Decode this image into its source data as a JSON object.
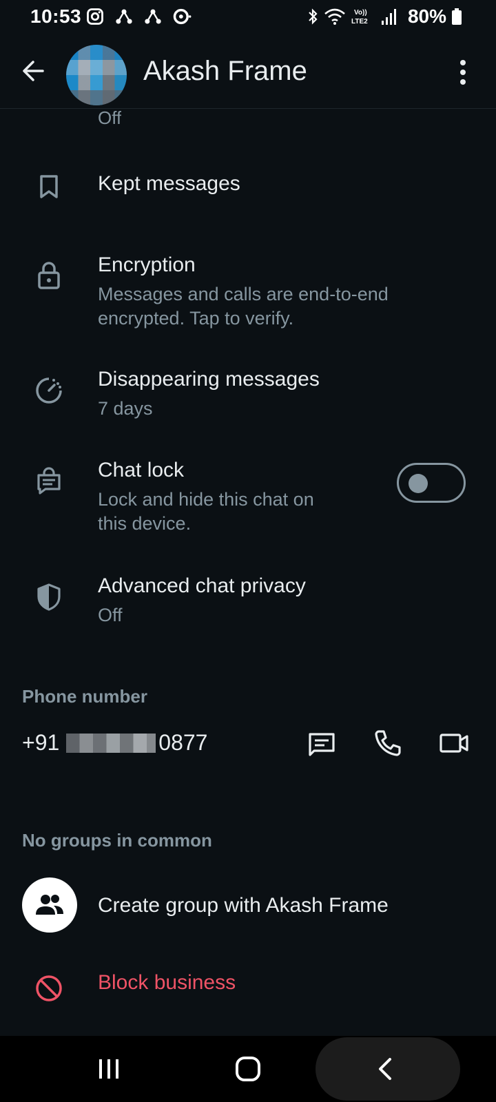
{
  "status_bar": {
    "time": "10:53",
    "battery": "80%",
    "network": "LTE2",
    "volte": "Vo))"
  },
  "header": {
    "title": "Akash Frame"
  },
  "cut_off_item": {
    "subtitle": "Off"
  },
  "rows": {
    "kept": {
      "title": "Kept messages"
    },
    "encryption": {
      "title": "Encryption",
      "subtitle": "Messages and calls are end-to-end encrypted. Tap to verify."
    },
    "disappearing": {
      "title": "Disappearing messages",
      "subtitle": "7 days"
    },
    "chat_lock": {
      "title": "Chat lock",
      "subtitle": "Lock and hide this chat on this device.",
      "enabled": false
    },
    "privacy": {
      "title": "Advanced chat privacy",
      "subtitle": "Off"
    }
  },
  "phone": {
    "section_label": "Phone number",
    "prefix": "+91",
    "suffix": "0877"
  },
  "groups": {
    "section_label": "No groups in common",
    "create_label": "Create group with Akash Frame"
  },
  "block": {
    "label": "Block business"
  },
  "colors": {
    "background": "#0b1014",
    "primary_text": "#e9edef",
    "secondary_text": "#8696a0",
    "danger": "#ef5366"
  }
}
